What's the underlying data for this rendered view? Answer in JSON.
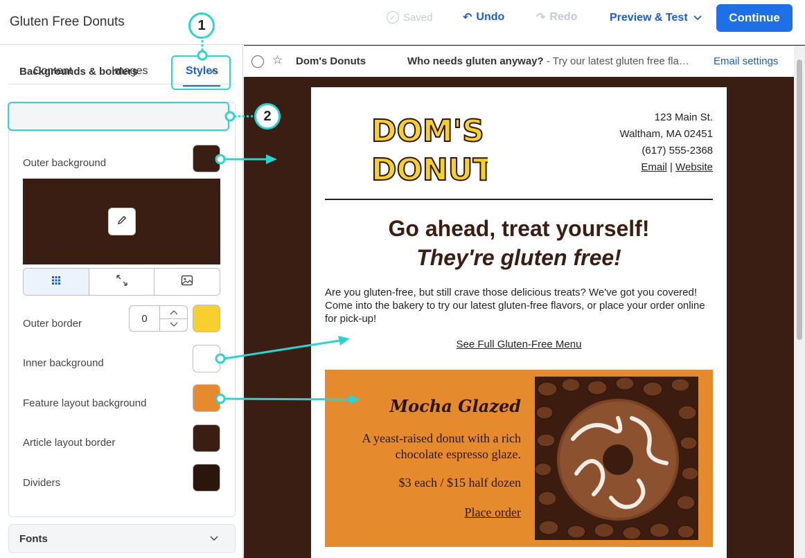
{
  "header": {
    "title": "Gluten Free Donuts",
    "saved_label": "Saved",
    "undo_label": "Undo",
    "redo_label": "Redo",
    "preview_label": "Preview & Test",
    "continue_label": "Continue"
  },
  "tabs": [
    {
      "label": "Content"
    },
    {
      "label": "Images"
    },
    {
      "label": "Styles"
    }
  ],
  "callouts": [
    "1",
    "2"
  ],
  "styles_panel": {
    "section_title": "Backgrounds & borders",
    "outer_background_label": "Outer background",
    "outer_border_label": "Outer border",
    "outer_border_value": "0",
    "inner_background_label": "Inner background",
    "feature_layout_background_label": "Feature layout background",
    "article_layout_border_label": "Article layout border",
    "dividers_label": "Dividers",
    "fonts_label": "Fonts"
  },
  "colors": {
    "outer_background": "#3a1d13",
    "outer_border": "#f7cf2e",
    "inner_background": "#ffffff",
    "feature_layout_background": "#e68a2e",
    "article_layout_border": "#3a1d13",
    "dividers": "#2b160d",
    "accent": "#1f6fe5",
    "callout": "#2bd4d0"
  },
  "inbox": {
    "from": "Dom's Donuts",
    "subject_bold": "Who needs gluten anyway?",
    "subject_rest": " - Try our latest gluten free fla…",
    "settings_link": "Email settings"
  },
  "email": {
    "logo_line1": "DOM'S",
    "logo_line2": "DONUTS",
    "address_line1": "123 Main St.",
    "address_line2": "Waltham, MA 02451",
    "phone": "(617) 555-2368",
    "email_link": "Email",
    "separator": "|",
    "website_link": "Website",
    "headline": "Go ahead, treat yourself!",
    "subheadline": "They're gluten free!",
    "body": "Are you gluten-free, but still crave those delicious treats? We've got you covered! Come into the bakery to try our latest gluten-free flavors, or place your order online for pick-up!",
    "menu_link": "See Full Gluten-Free Menu",
    "feature": {
      "title": "Mocha Glazed",
      "description": "A yeast-raised donut with a rich chocolate espresso glaze.",
      "price": "$3 each / $15 half dozen",
      "order_link": "Place order"
    }
  }
}
